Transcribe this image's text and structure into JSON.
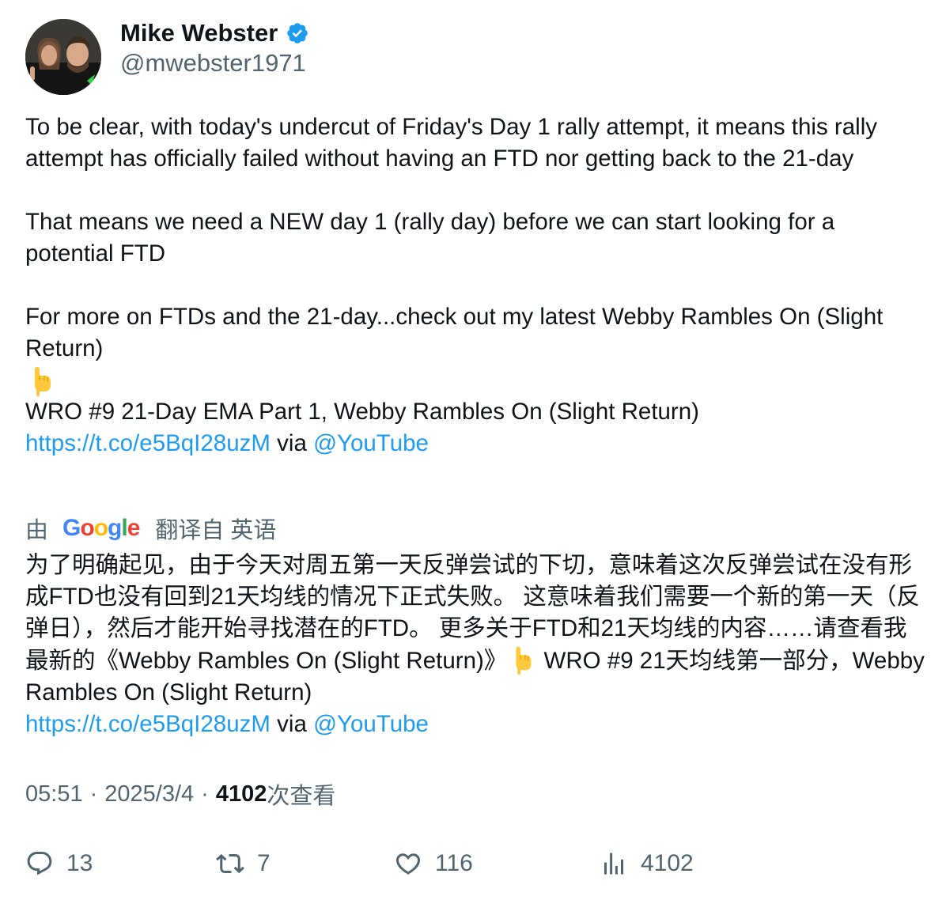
{
  "author": {
    "name": "Mike Webster",
    "handle": "@mwebster1971",
    "verified": true
  },
  "tweet": {
    "line1": "To be clear, with today's undercut of Friday's Day 1 rally attempt, it means this rally attempt has officially failed without having an FTD nor getting back to the 21-day",
    "line2": "That means we need a NEW day 1 (rally day) before we can start looking for a potential FTD",
    "line3": "For more on FTDs and the 21-day...check out my latest Webby Rambles On (Slight Return)",
    "video_title": "WRO #9 21-Day EMA Part 1, Webby Rambles On (Slight Return)",
    "link": "https://t.co/e5BqI28uzM",
    "via": "via",
    "mention": "@YouTube"
  },
  "translation": {
    "prefix": "由",
    "provider": "Google",
    "suffix": "翻译自 英语",
    "text_part1": "为了明确起见，由于今天对周五第一天反弹尝试的下切，意味着这次反弹尝试在没有形成FTD也没有回到21天均线的情况下正式失败。 这意味着我们需要一个新的第一天（反弹日），然后才能开始寻找潜在的FTD。 更多关于FTD和21天均线的内容……请查看我最新的《Webby Rambles On (Slight Return)》",
    "text_part2": " WRO #9 21天均线第一部分，Webby Rambles On (Slight Return)",
    "link": "https://t.co/e5BqI28uzM",
    "via": "via",
    "mention": "@YouTube"
  },
  "meta": {
    "time": "05:51",
    "date": "2025/3/4",
    "views": "4102",
    "views_label": "次查看"
  },
  "actions": {
    "replies": "13",
    "retweets": "7",
    "likes": "116",
    "views": "4102"
  },
  "colors": {
    "link": "#1d9bf0",
    "secondary_text": "#536471",
    "verified_badge": "#1d9bf0"
  },
  "icons": [
    "verified-badge-icon",
    "pointing-down-emoji",
    "reply-icon",
    "retweet-icon",
    "like-icon",
    "views-icon"
  ]
}
